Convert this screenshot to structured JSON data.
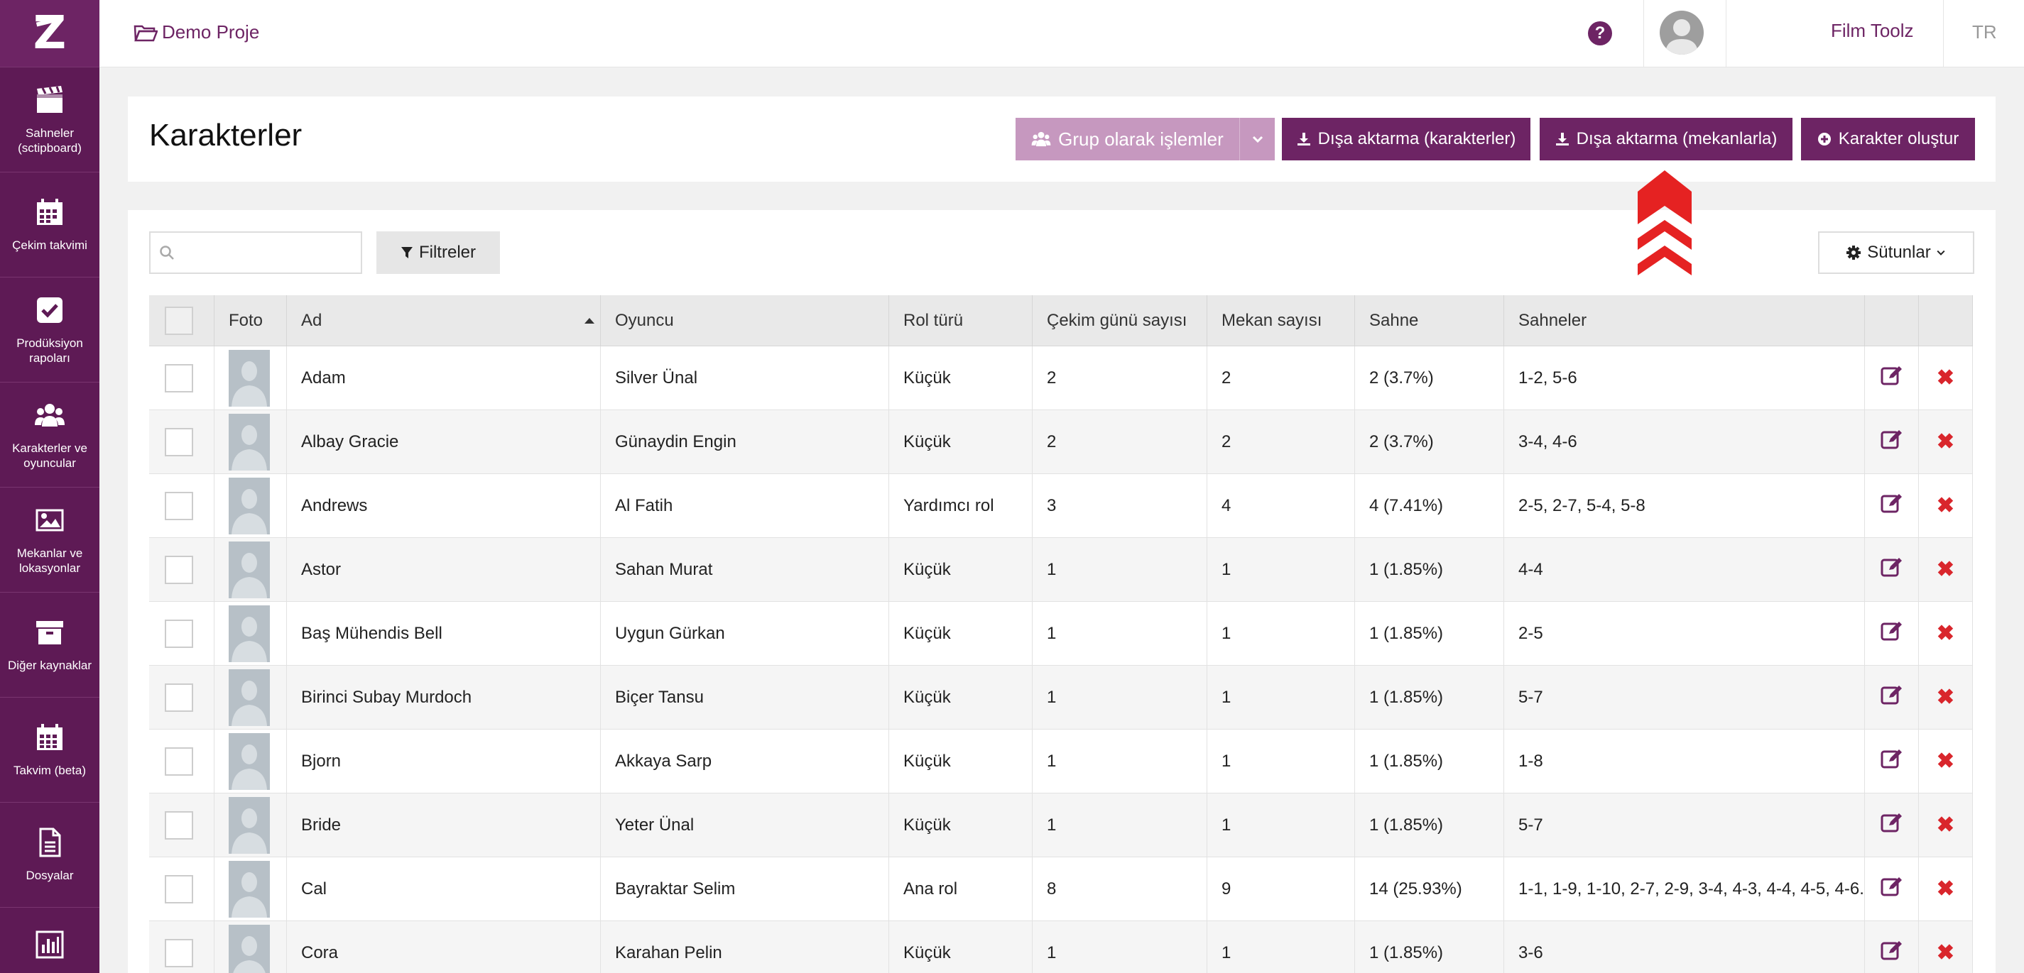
{
  "sidebar": {
    "logo_text": "Z",
    "items": [
      {
        "label": "Sahneler (sctipboard)",
        "icon": "clapperboard-icon"
      },
      {
        "label": "Çekim takvimi",
        "icon": "calendar-icon"
      },
      {
        "label": "Prodüksiyon rapoları",
        "icon": "checkbox-icon"
      },
      {
        "label": "Karakterler ve oyuncular",
        "icon": "users-icon"
      },
      {
        "label": "Mekanlar ve lokasyonlar",
        "icon": "image-icon"
      },
      {
        "label": "Diğer kaynaklar",
        "icon": "archive-icon"
      },
      {
        "label": "Takvim (beta)",
        "icon": "calendar-grid-icon"
      },
      {
        "label": "Dosyalar",
        "icon": "file-icon"
      },
      {
        "label": "",
        "icon": "bar-chart-icon"
      }
    ]
  },
  "topbar": {
    "project": "Demo Proje",
    "help_icon": "question-circle-icon",
    "mail_icon": "envelope-icon",
    "username": "Film Toolz",
    "language": "TR"
  },
  "header": {
    "title": "Karakterler",
    "group_button": "Grup olarak işlemler",
    "export_characters": "Dışa aktarma (karakterler)",
    "export_locations": "Dışa aktarma (mekanlarla)",
    "create_character": "Karakter oluştur"
  },
  "toolbar": {
    "search_value": "",
    "search_placeholder": "",
    "filters": "Filtreler",
    "columns": "Sütunlar"
  },
  "colors": {
    "brand": "#6d2464",
    "sidebar": "#5e1a55",
    "group_button": "#c698bf",
    "delete": "#d9262c",
    "annotation_arrow": "#e52222"
  },
  "table": {
    "headers": {
      "foto": "Foto",
      "ad": "Ad",
      "oyuncu": "Oyuncu",
      "rol": "Rol türü",
      "gun": "Çekim günü sayısı",
      "mekan": "Mekan sayısı",
      "sahne": "Sahne",
      "sahneler": "Sahneler"
    },
    "rows": [
      {
        "ad": "Adam",
        "oyuncu": "Silver Ünal",
        "rol": "Küçük",
        "gun": "2",
        "mekan": "2",
        "sahne": "2 (3.7%)",
        "sahneler": "1-2, 5-6"
      },
      {
        "ad": "Albay Gracie",
        "oyuncu": "Günaydin Engin",
        "rol": "Küçük",
        "gun": "2",
        "mekan": "2",
        "sahne": "2 (3.7%)",
        "sahneler": "3-4, 4-6"
      },
      {
        "ad": "Andrews",
        "oyuncu": "Al Fatih",
        "rol": "Yardımcı rol",
        "gun": "3",
        "mekan": "4",
        "sahne": "4 (7.41%)",
        "sahneler": "2-5, 2-7, 5-4, 5-8"
      },
      {
        "ad": "Astor",
        "oyuncu": "Sahan Murat",
        "rol": "Küçük",
        "gun": "1",
        "mekan": "1",
        "sahne": "1 (1.85%)",
        "sahneler": "4-4"
      },
      {
        "ad": "Baş Mühendis Bell",
        "oyuncu": "Uygun Gürkan",
        "rol": "Küçük",
        "gun": "1",
        "mekan": "1",
        "sahne": "1 (1.85%)",
        "sahneler": "2-5"
      },
      {
        "ad": "Birinci Subay Murdoch",
        "oyuncu": "Biçer Tansu",
        "rol": "Küçük",
        "gun": "1",
        "mekan": "1",
        "sahne": "1 (1.85%)",
        "sahneler": "5-7"
      },
      {
        "ad": "Bjorn",
        "oyuncu": "Akkaya Sarp",
        "rol": "Küçük",
        "gun": "1",
        "mekan": "1",
        "sahne": "1 (1.85%)",
        "sahneler": "1-8"
      },
      {
        "ad": "Bride",
        "oyuncu": "Yeter Ünal",
        "rol": "Küçük",
        "gun": "1",
        "mekan": "1",
        "sahne": "1 (1.85%)",
        "sahneler": "5-7"
      },
      {
        "ad": "Cal",
        "oyuncu": "Bayraktar Selim",
        "rol": "Ana rol",
        "gun": "8",
        "mekan": "9",
        "sahne": "14 (25.93%)",
        "sahneler": "1-1, 1-9, 1-10, 2-7, 2-9, 3-4, 4-3, 4-4, 4-5, 4-6..."
      },
      {
        "ad": "Cora",
        "oyuncu": "Karahan Pelin",
        "rol": "Küçük",
        "gun": "1",
        "mekan": "1",
        "sahne": "1 (1.85%)",
        "sahneler": "3-6"
      }
    ]
  }
}
